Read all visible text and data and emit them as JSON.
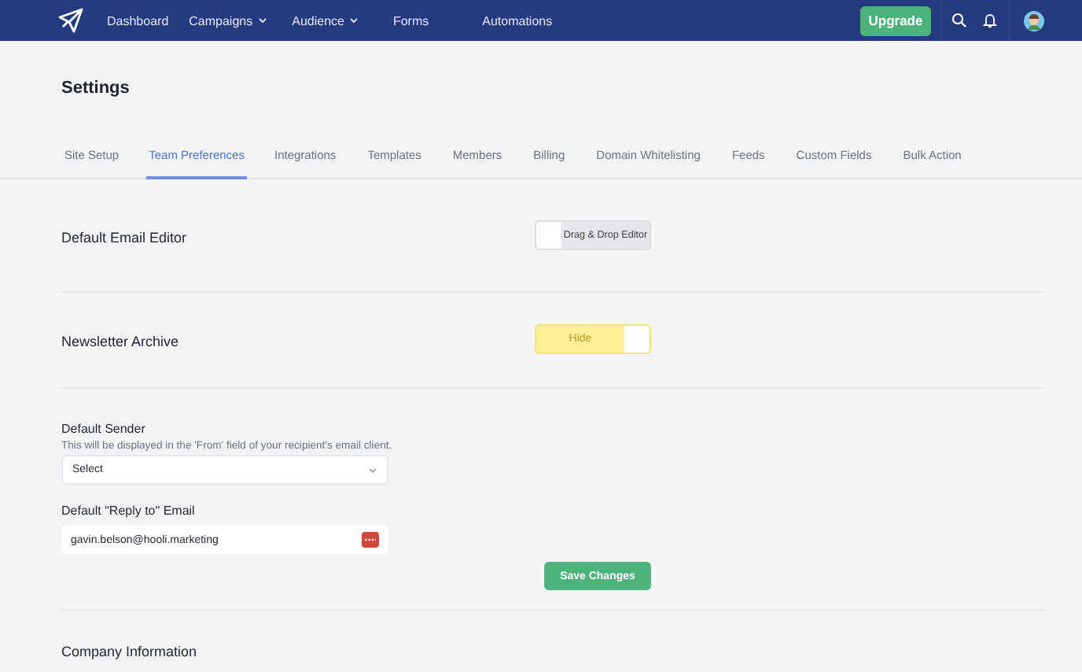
{
  "nav": {
    "items": [
      {
        "label": "Dashboard",
        "dropdown": false
      },
      {
        "label": "Campaigns",
        "dropdown": true
      },
      {
        "label": "Audience",
        "dropdown": true
      },
      {
        "label": "Forms",
        "dropdown": false
      },
      {
        "label": "Automations",
        "dropdown": false
      }
    ],
    "upgrade": "Upgrade"
  },
  "page_title": "Settings",
  "tabs": [
    {
      "label": "Site Setup",
      "selected": false
    },
    {
      "label": "Team Preferences",
      "selected": true
    },
    {
      "label": "Integrations",
      "selected": false
    },
    {
      "label": "Templates",
      "selected": false
    },
    {
      "label": "Members",
      "selected": false
    },
    {
      "label": "Billing",
      "selected": false
    },
    {
      "label": "Domain Whitelisting",
      "selected": false
    },
    {
      "label": "Feeds",
      "selected": false
    },
    {
      "label": "Custom Fields",
      "selected": false
    },
    {
      "label": "Bulk Action",
      "selected": false
    }
  ],
  "toggles": [
    {
      "label": "Default Email Editor",
      "text": "Drag & Drop Editor",
      "on": false
    },
    {
      "label": "Newsletter Archive",
      "text": "Hide",
      "on": true
    }
  ],
  "sender": {
    "label": "Default Sender",
    "hint": "This will be displayed in the 'From' field of your recipient's email client.",
    "value": "Select"
  },
  "reply_to": {
    "label": "Default \"Reply to\" Email",
    "value": "gavin.belson@hooli.marketing"
  },
  "save": "Save Changes",
  "next_section": "Company Information"
}
